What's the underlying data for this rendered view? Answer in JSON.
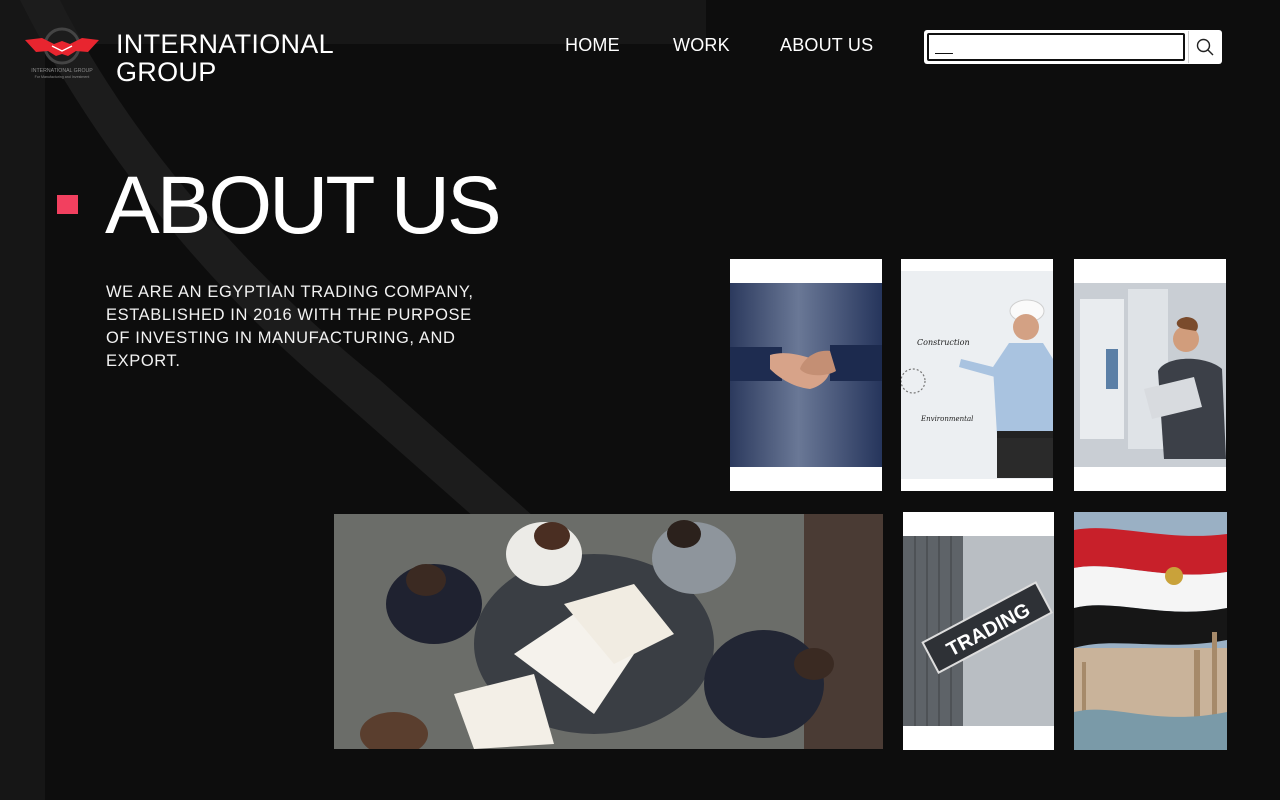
{
  "brand": {
    "name_line1": "INTERNATIONAL",
    "name_line2": "GROUP",
    "logo_text_1": "INTERNATIONAL GROUP",
    "logo_text_2": "For Manufacturing and Investment",
    "logo_color": "#e8252f"
  },
  "nav": {
    "items": [
      {
        "label": "HOME"
      },
      {
        "label": "WORK"
      },
      {
        "label": "ABOUT US"
      }
    ]
  },
  "search": {
    "value": "__",
    "icon": "search-icon"
  },
  "hero": {
    "title": "ABOUT US",
    "accent_color": "#f2405f",
    "intro": "WE ARE AN EGYPTIAN TRADING COMPANY, ESTABLISHED IN 2016 WITH THE PURPOSE OF INVESTING IN MANUFACTURING, AND EXPORT."
  },
  "gallery": {
    "engineer_labels": [
      "Construction",
      "Environmental"
    ],
    "trading_sign": "TRADING"
  }
}
